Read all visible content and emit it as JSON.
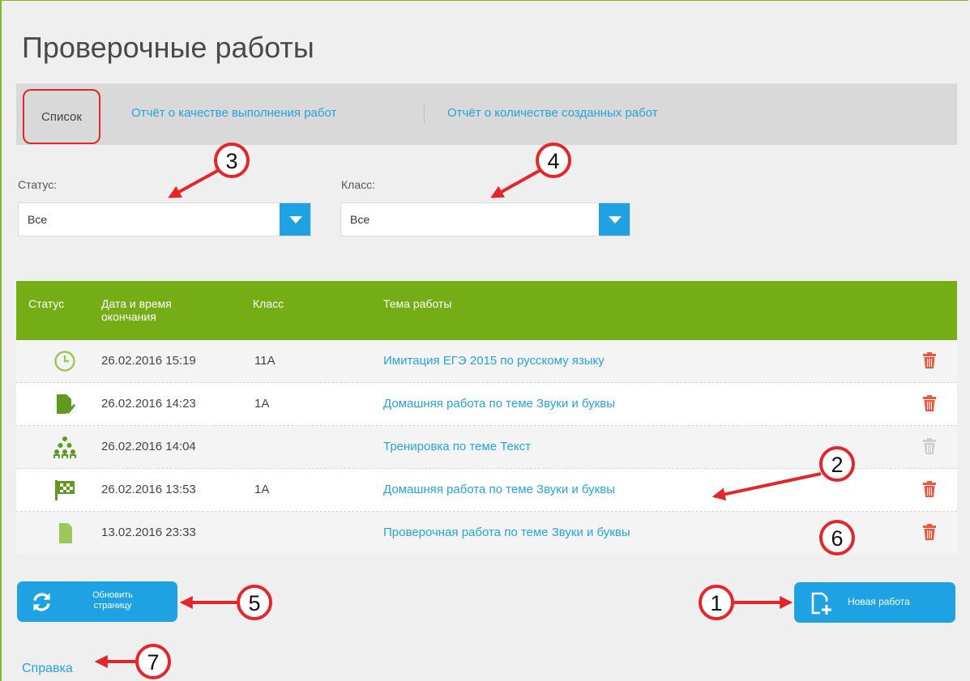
{
  "page": {
    "title": "Проверочные работы"
  },
  "tabs": {
    "list": "Список",
    "quality_report": "Отчёт о качестве выполнения работ",
    "count_report": "Отчёт о количестве созданных работ"
  },
  "filters": {
    "status": {
      "label": "Статус:",
      "value": "Все"
    },
    "class": {
      "label": "Класс:",
      "value": "Все"
    }
  },
  "table": {
    "headers": [
      "Статус",
      "Дата и время окончания",
      "Класс",
      "Тема работы"
    ],
    "header_lines": {
      "date_1": "Дата и время",
      "date_2": "окончания"
    },
    "rows": [
      {
        "status_icon": "clock-icon",
        "date": "26.02.2016 15:19",
        "class": "11А",
        "topic": "Имитация ЕГЭ 2015 по русскому языку",
        "delete_enabled": true
      },
      {
        "status_icon": "checked-document-icon",
        "date": "26.02.2016 14:23",
        "class": "1А",
        "topic": "Домашняя работа по теме Звуки и буквы",
        "delete_enabled": true
      },
      {
        "status_icon": "hierarchy-icon",
        "date": "26.02.2016 14:04",
        "class": "",
        "topic": "Тренировка по теме Текст",
        "delete_enabled": false
      },
      {
        "status_icon": "checkered-flag-icon",
        "date": "26.02.2016 13:53",
        "class": "1А",
        "topic": "Домашняя работа по теме Звуки и буквы",
        "delete_enabled": true
      },
      {
        "status_icon": "blank-document-icon",
        "date": "13.02.2016 23:33",
        "class": "",
        "topic": "Проверочная работа по теме Звуки и буквы",
        "delete_enabled": true
      }
    ]
  },
  "buttons": {
    "refresh_1": "Обновить",
    "refresh_2": "страницу",
    "new_work": "Новая работа"
  },
  "help_link": "Справка",
  "annotations": [
    "1",
    "2",
    "3",
    "4",
    "5",
    "6",
    "7"
  ],
  "colors": {
    "header_green": "#74ad16",
    "accent_blue": "#1ea2e3",
    "link_blue": "#25a3dd",
    "delete_red": "#f0553f",
    "annotation_red": "#e3262a"
  }
}
